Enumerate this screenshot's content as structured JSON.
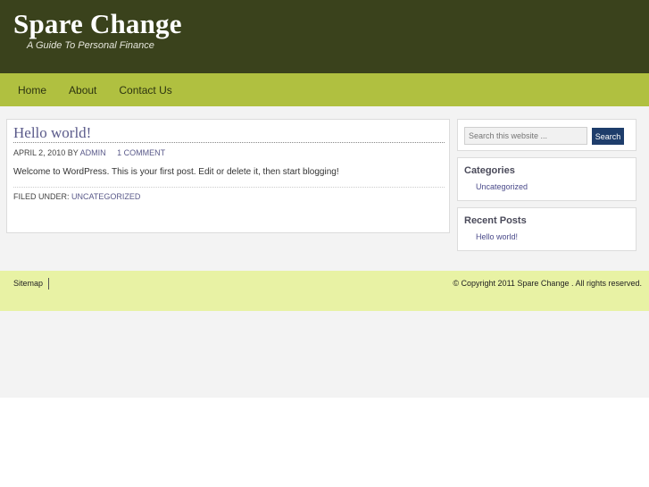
{
  "header": {
    "title": "Spare Change",
    "description": "A Guide To Personal Finance"
  },
  "nav": {
    "items": [
      "Home",
      "About",
      "Contact Us"
    ]
  },
  "post": {
    "title": "Hello world!",
    "date": "April 2, 2010",
    "by": "by",
    "author": "admin",
    "comments": "1 Comment",
    "body": "Welcome to WordPress. This is your first post. Edit or delete it, then start blogging!",
    "filed_label": "Filed Under:",
    "category": "Uncategorized"
  },
  "sidebar": {
    "search_placeholder": "Search this website ...",
    "search_button": "Search",
    "categories_title": "Categories",
    "categories": [
      "Uncategorized"
    ],
    "recent_title": "Recent Posts",
    "recent": [
      "Hello world!"
    ]
  },
  "footer": {
    "sitemap": "Sitemap",
    "copyright": "© Copyright 2011 Spare Change . All rights reserved."
  },
  "colors": {
    "header_bg": "#3a421c",
    "nav_bg": "#b0c040",
    "footer_bg": "#e8f2a4",
    "link": "#5a5a8a",
    "search_button": "#1e3d6b"
  }
}
